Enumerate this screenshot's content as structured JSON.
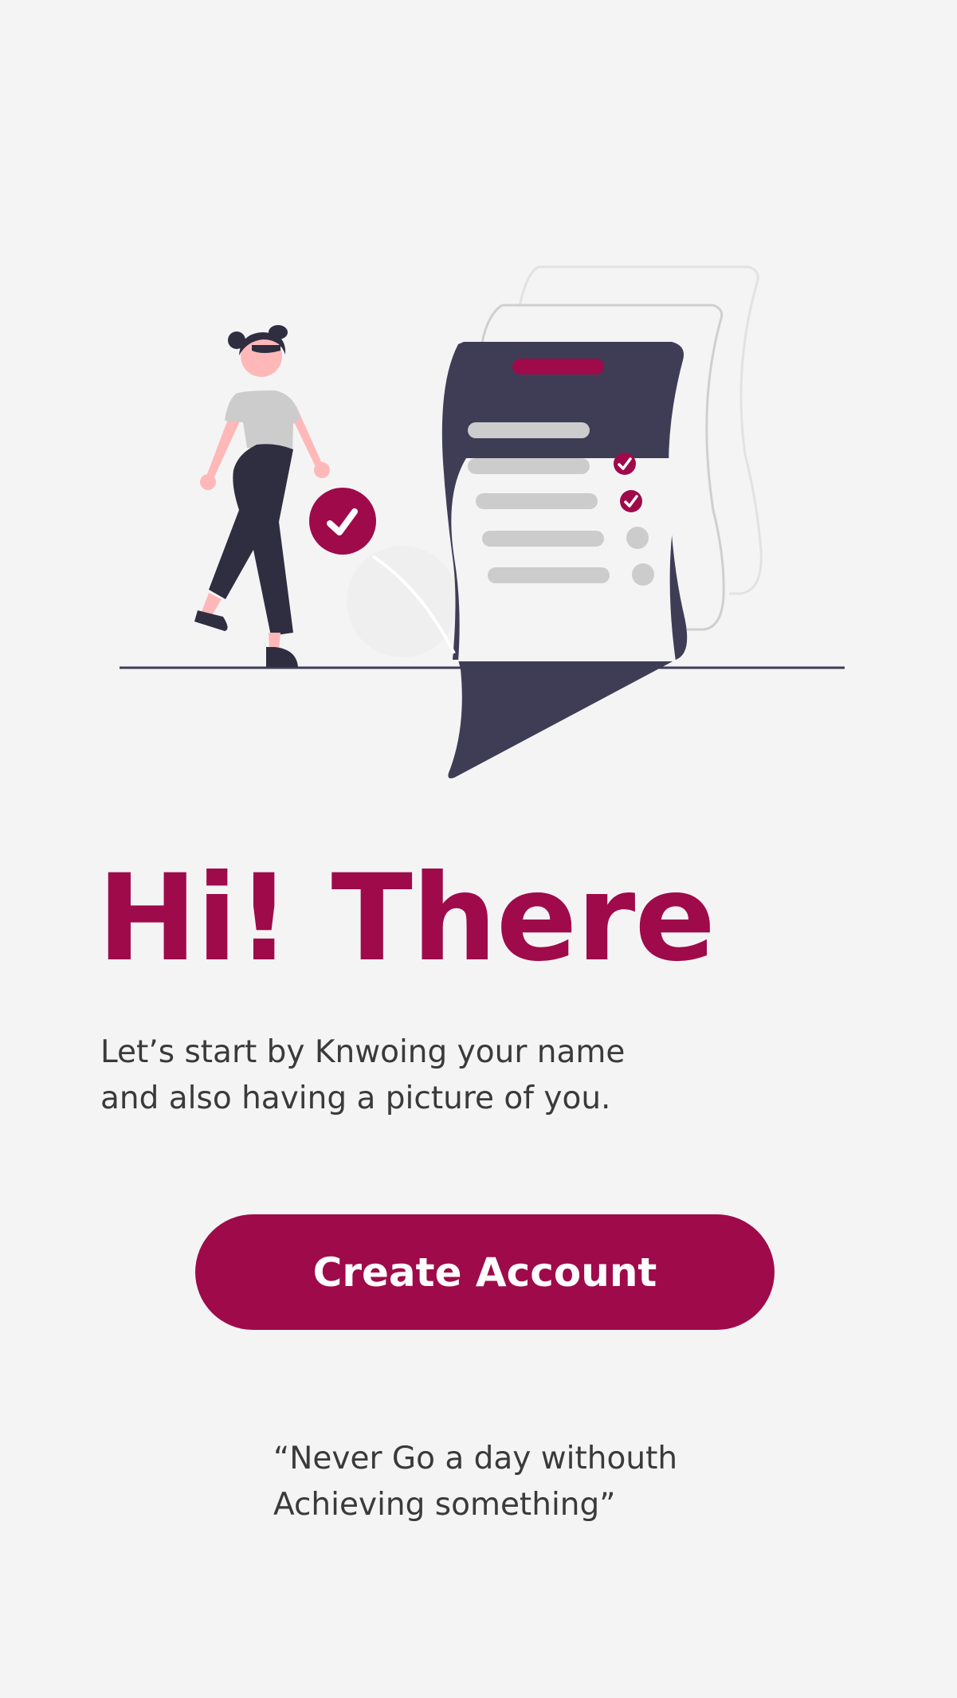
{
  "colors": {
    "accent": "#9f0a4a",
    "background": "#f4f4f5",
    "text": "#3a3a3a",
    "dark": "#3f3d56",
    "button_text": "#ffffff"
  },
  "illustration": {
    "icon": "checklist-illustration"
  },
  "welcome": {
    "title": "Hi! There",
    "subtitle_line1": "Let’s start by Knwoing your name",
    "subtitle_line2": "and also having a picture of you."
  },
  "cta": {
    "label": "Create Account"
  },
  "quote": {
    "line1": "“Never Go a day withouth",
    "line2": "Achieving something”"
  }
}
